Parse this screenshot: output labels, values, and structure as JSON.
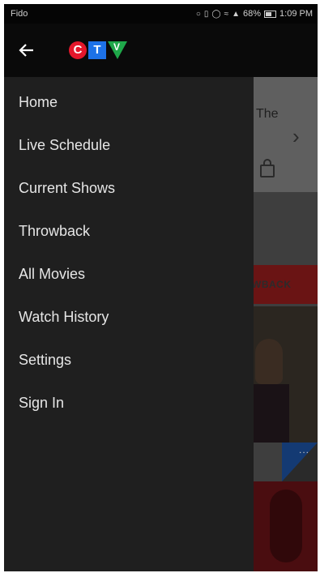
{
  "status_bar": {
    "carrier": "Fido",
    "battery": "68%",
    "time": "1:09 PM"
  },
  "app_bar": {
    "back_icon": "arrow-left-icon",
    "logo": {
      "c": "C",
      "t": "T",
      "v": "V"
    },
    "logo_colors": {
      "c": "#e4172b",
      "t": "#1d72e8",
      "v": "#1fa84a"
    }
  },
  "drawer": {
    "items": [
      {
        "label": "Home"
      },
      {
        "label": "Live Schedule"
      },
      {
        "label": "Current Shows"
      },
      {
        "label": "Throwback"
      },
      {
        "label": "All Movies"
      },
      {
        "label": "Watch History"
      },
      {
        "label": "Settings"
      },
      {
        "label": "Sign In"
      }
    ]
  },
  "background": {
    "title_fragment": "The",
    "band_label": "WBACK",
    "more_label": "..."
  }
}
